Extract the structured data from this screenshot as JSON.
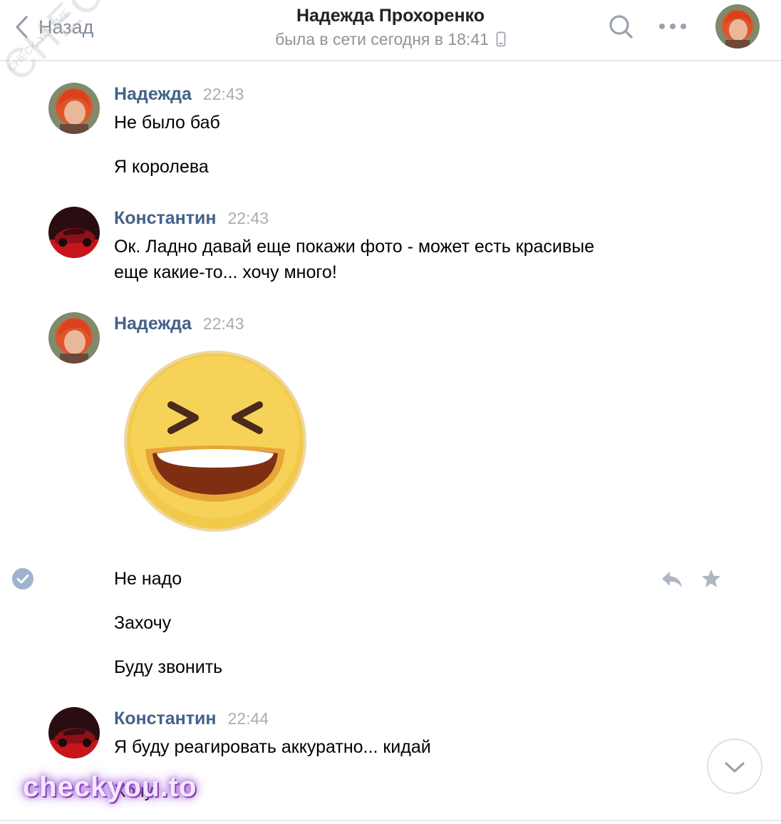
{
  "header": {
    "back_label": "Назад",
    "title": "Надежда Прохоренко",
    "status": "была в сети сегодня в 18:41"
  },
  "icons": {
    "back": "chevron-left-icon",
    "search": "search-icon",
    "more": "more-horizontal-icon",
    "mobile": "mobile-phone-icon",
    "read": "check-circle-icon",
    "reply": "reply-icon",
    "star": "star-icon",
    "scroll": "chevron-down-icon"
  },
  "colors": {
    "author": "#43618a",
    "time": "#a8adb4",
    "accent": "#818c99"
  },
  "messages": [
    {
      "author": "Надежда",
      "time": "22:43",
      "lines": [
        "Не было баб",
        "Я королева"
      ]
    },
    {
      "author": "Константин",
      "time": "22:43",
      "lines": [
        "Ок. Ладно давай еще покажи фото - может есть красивые",
        "еще какие-то... хочу много!"
      ]
    },
    {
      "author": "Надежда",
      "time": "22:43",
      "sticker": "laughing-face-sticker",
      "lines": [
        "Не надо",
        "Захочу",
        "Буду звонить"
      ]
    },
    {
      "author": "Константин",
      "time": "22:44",
      "lines": [
        "Я буду реагировать аккуратно... кидай",
        "Хочу"
      ]
    }
  ],
  "watermarks": {
    "diagonal": "CHECKYOU.ME",
    "small": "CHECK-YOU.ME",
    "bottom": "checkyou.to"
  }
}
